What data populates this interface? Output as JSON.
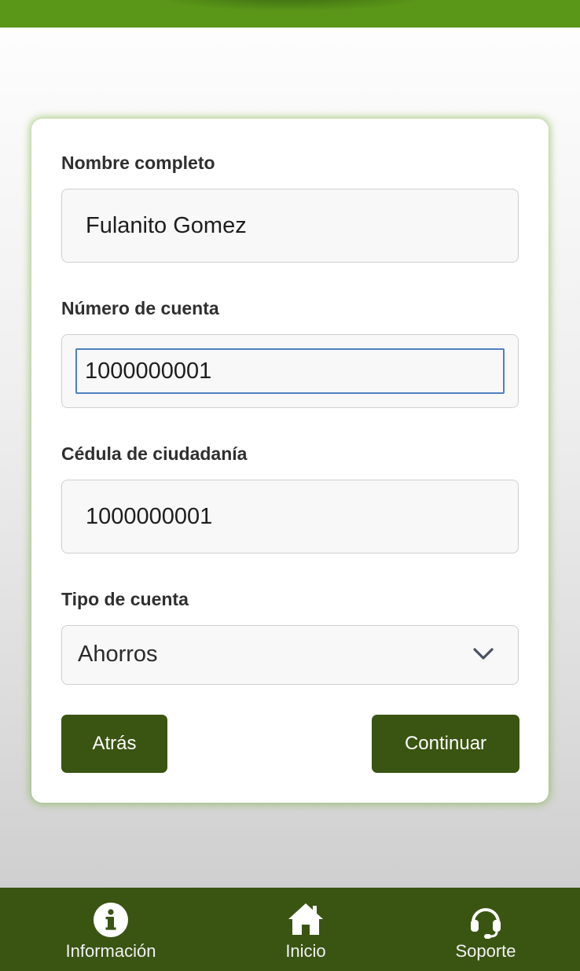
{
  "form": {
    "full_name": {
      "label": "Nombre completo",
      "value": "Fulanito Gomez"
    },
    "account_number": {
      "label": "Número de cuenta",
      "value": "1000000001"
    },
    "id_number": {
      "label": "Cédula de ciudadanía",
      "value": "1000000001"
    },
    "account_type": {
      "label": "Tipo de cuenta",
      "selected": "Ahorros"
    },
    "back_label": "Atrás",
    "continue_label": "Continuar"
  },
  "nav": {
    "items": [
      {
        "label": "Información",
        "icon": "info-icon"
      },
      {
        "label": "Inicio",
        "icon": "home-icon"
      },
      {
        "label": "Soporte",
        "icon": "headset-icon"
      }
    ]
  },
  "colors": {
    "header_green": "#5a9618",
    "dark_green": "#3a5412",
    "focus_blue": "#4f7fc0"
  }
}
